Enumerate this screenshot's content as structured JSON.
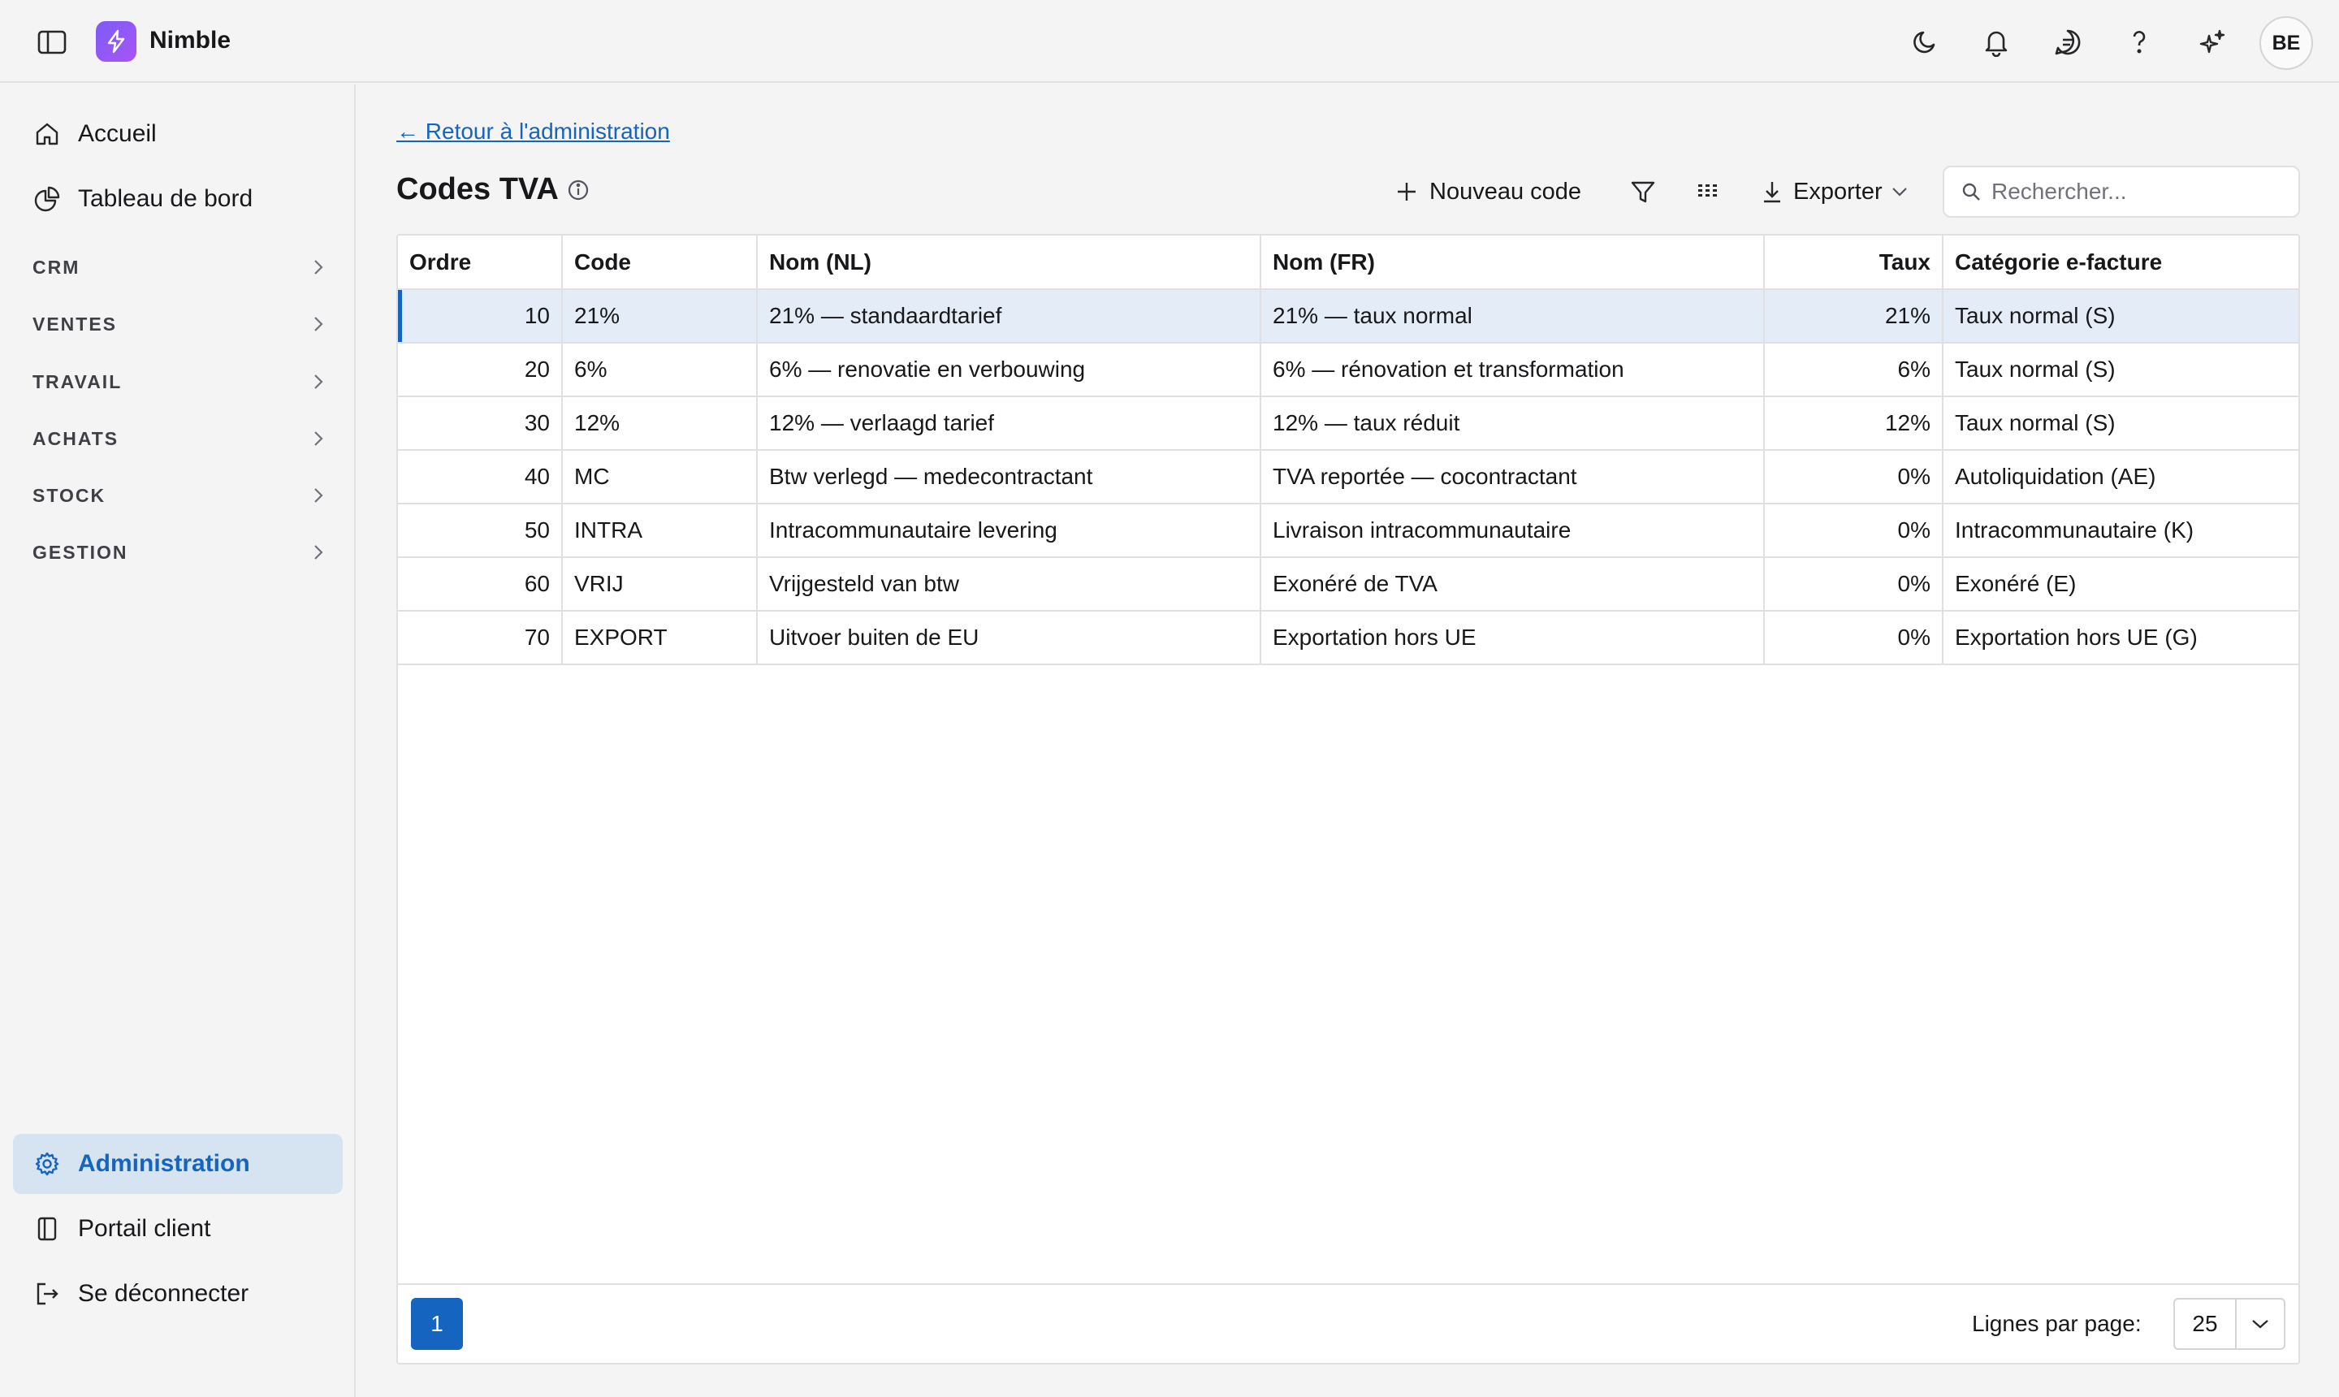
{
  "app": {
    "name": "Nimble",
    "user_initials": "BE"
  },
  "colors": {
    "accent": "#1565c0",
    "logo_gradient_start": "#7c5cf5",
    "logo_gradient_end": "#a855f7",
    "selected_row": "#e3ecf7",
    "active_nav": "#d6e4f1"
  },
  "topbar": {
    "icons": [
      "sidebar-toggle-icon",
      "moon-icon",
      "bell-icon",
      "chat-icon",
      "help-icon",
      "sparkles-icon"
    ]
  },
  "sidebar": {
    "top_items": [
      {
        "label": "Accueil",
        "icon": "home-icon"
      },
      {
        "label": "Tableau de bord",
        "icon": "pie-chart-icon"
      }
    ],
    "sections": [
      "CRM",
      "VENTES",
      "TRAVAIL",
      "ACHATS",
      "STOCK",
      "GESTION"
    ],
    "bottom_items": [
      {
        "label": "Administration",
        "icon": "gear-icon",
        "active": true
      },
      {
        "label": "Portail client",
        "icon": "book-icon"
      },
      {
        "label": "Se déconnecter",
        "icon": "logout-icon"
      }
    ]
  },
  "main": {
    "back_link": "← Retour à l'administration",
    "title": "Codes TVA",
    "toolbar": {
      "new_label": "Nouveau code",
      "export_label": "Exporter",
      "search_placeholder": "Rechercher..."
    },
    "table": {
      "columns": [
        "Ordre",
        "Code",
        "Nom (NL)",
        "Nom (FR)",
        "Taux",
        "Catégorie e-facture"
      ],
      "rows": [
        {
          "ordre": "10",
          "code": "21%",
          "nom_nl": "21% — standaardtarief",
          "nom_fr": "21% — taux normal",
          "taux": "21%",
          "categorie": "Taux normal (S)",
          "selected": true
        },
        {
          "ordre": "20",
          "code": "6%",
          "nom_nl": "6% — renovatie en verbouwing",
          "nom_fr": "6% — rénovation et transformation",
          "taux": "6%",
          "categorie": "Taux normal (S)"
        },
        {
          "ordre": "30",
          "code": "12%",
          "nom_nl": "12% — verlaagd tarief",
          "nom_fr": "12% — taux réduit",
          "taux": "12%",
          "categorie": "Taux normal (S)"
        },
        {
          "ordre": "40",
          "code": "MC",
          "nom_nl": "Btw verlegd — medecontractant",
          "nom_fr": "TVA reportée — cocontractant",
          "taux": "0%",
          "categorie": "Autoliquidation (AE)"
        },
        {
          "ordre": "50",
          "code": "INTRA",
          "nom_nl": "Intracommunautaire levering",
          "nom_fr": "Livraison intracommunautaire",
          "taux": "0%",
          "categorie": "Intracommunautaire (K)"
        },
        {
          "ordre": "60",
          "code": "VRIJ",
          "nom_nl": "Vrijgesteld van btw",
          "nom_fr": "Exonéré de TVA",
          "taux": "0%",
          "categorie": "Exonéré (E)"
        },
        {
          "ordre": "70",
          "code": "EXPORT",
          "nom_nl": "Uitvoer buiten de EU",
          "nom_fr": "Exportation hors UE",
          "taux": "0%",
          "categorie": "Exportation hors UE (G)"
        }
      ]
    },
    "pagination": {
      "current_page": "1",
      "rows_per_page_label": "Lignes par page:",
      "rows_per_page": "25"
    }
  }
}
